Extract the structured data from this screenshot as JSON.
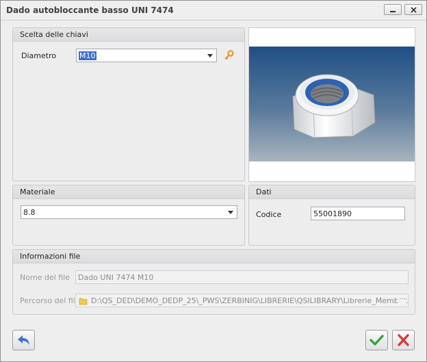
{
  "window": {
    "title": "Dado autobloccante basso UNI 7474"
  },
  "key_group": {
    "title": "Scelta delle chiavi",
    "diameter_label": "Diametro",
    "diameter_value": "M10"
  },
  "material_group": {
    "title": "Materiale",
    "value": "8.8"
  },
  "data_group": {
    "title": "Dati",
    "code_label": "Codice",
    "code_value": "55001890"
  },
  "file_group": {
    "title": "Informazioni file",
    "filename_label": "Nome del file",
    "filename_value": "Dado UNI 7474 M10",
    "path_label": "Percorso del file",
    "path_value": "D:\\QS_DED\\DEMO_DEDP_25\\_PWS\\ZERBINIG\\LIBRERIE\\QSILIBRARY\\Librerie_Member...",
    "browse_label": "···"
  },
  "icons": {
    "key": "key-icon",
    "back": "arrow-back-icon",
    "ok": "checkmark-icon",
    "cancel": "x-icon",
    "folder": "folder-icon",
    "minimize": "minimize-icon",
    "close": "close-icon"
  },
  "colors": {
    "accent_selection": "#3a6fcf",
    "ok_green": "#3aa33a",
    "cancel_red": "#d63a3a",
    "back_blue": "#3f73c9",
    "key_orange": "#e59a1f"
  }
}
